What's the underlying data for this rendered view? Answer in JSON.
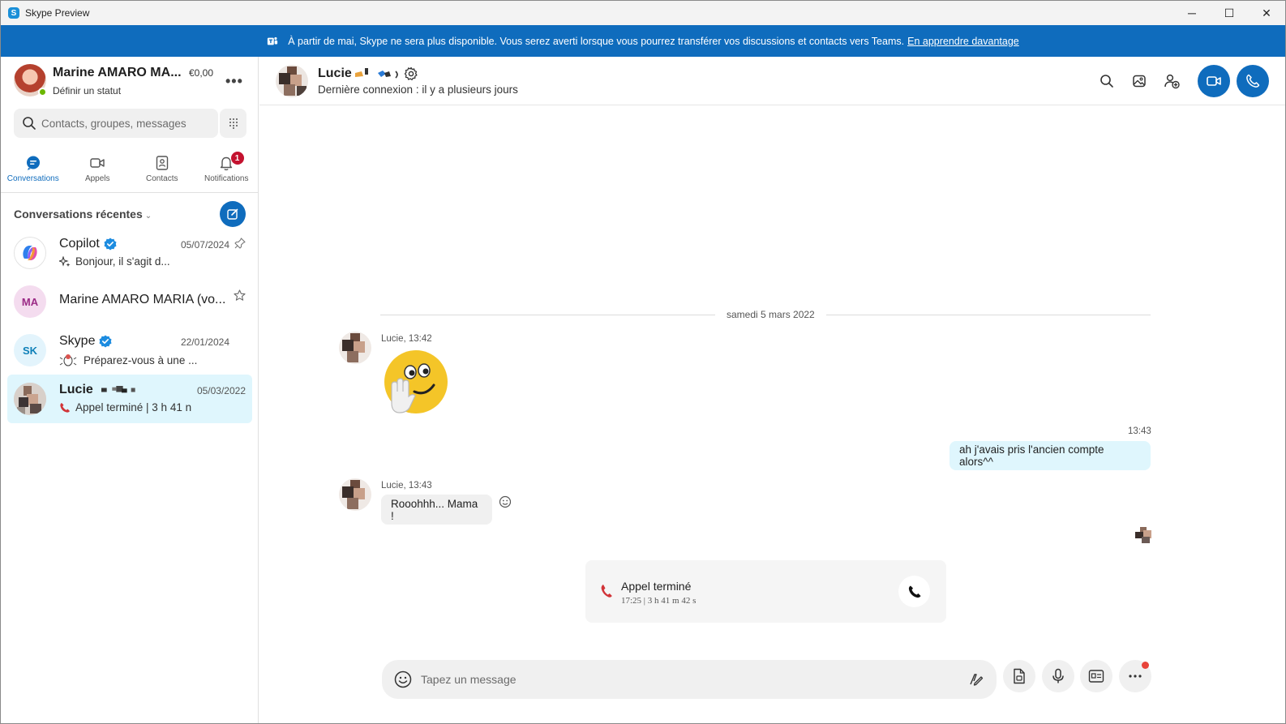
{
  "window": {
    "title": "Skype Preview",
    "controls": {
      "minimize": "─",
      "maximize": "☐",
      "close": "✕"
    }
  },
  "banner": {
    "text": "À partir de mai, Skype ne sera plus disponible. Vous serez averti lorsque vous pourrez transférer vos discussions et contacts vers Teams.",
    "link": "En apprendre davantage",
    "icon": "teams-icon"
  },
  "profile": {
    "name": "Marine AMARO MA...",
    "credit": "€0,00",
    "status": "Définir un statut",
    "more": "•••",
    "presence_color": "#6bb700"
  },
  "search": {
    "placeholder": "Contacts, groupes, messages"
  },
  "nav": {
    "tabs": [
      {
        "label": "Conversations",
        "icon": "chat-icon",
        "active": true
      },
      {
        "label": "Appels",
        "icon": "video-icon"
      },
      {
        "label": "Contacts",
        "icon": "contact-card-icon"
      },
      {
        "label": "Notifications",
        "icon": "bell-icon",
        "badge": "1"
      }
    ]
  },
  "recent": {
    "header": "Conversations récentes",
    "chevron": "⌄",
    "items": [
      {
        "name": "Copilot",
        "date": "05/07/2024",
        "preview": "Bonjour, il s'agit d...",
        "verified": true,
        "pinned": true
      },
      {
        "name": "Marine AMARO MARIA (vo...",
        "initials": "MA",
        "favorite": true
      },
      {
        "name": "Skype",
        "initials": "SK",
        "date": "22/01/2024",
        "preview": "Préparez-vous à une ...",
        "verified": true
      },
      {
        "name": "Lucie",
        "date": "05/03/2022",
        "preview": "Appel terminé | 3 h 41 n",
        "selected": true
      }
    ]
  },
  "chat": {
    "contact_name": "Lucie",
    "last_seen": "Dernière connexion : il y a plusieurs jours",
    "date_separator": "samedi 5 mars 2022",
    "messages": [
      {
        "sender_meta": "Lucie, 13:42",
        "type": "emoji",
        "emoji": "waving-face-emoji"
      },
      {
        "time": "13:43",
        "type": "outgoing",
        "text": "ah j'avais pris l'ancien compte alors^^"
      },
      {
        "sender_meta": "Lucie, 13:43",
        "type": "incoming",
        "text": "Rooohhh... Mama !"
      }
    ],
    "call": {
      "title": "Appel terminé",
      "detail": "17:25 | 3 h 41 m 42 s"
    },
    "composer": {
      "placeholder": "Tapez un message"
    }
  },
  "colors": {
    "accent": "#0f6cbd",
    "selected_bg": "#dff6fd",
    "badge_red": "#c4122f",
    "call_red": "#d13438"
  }
}
